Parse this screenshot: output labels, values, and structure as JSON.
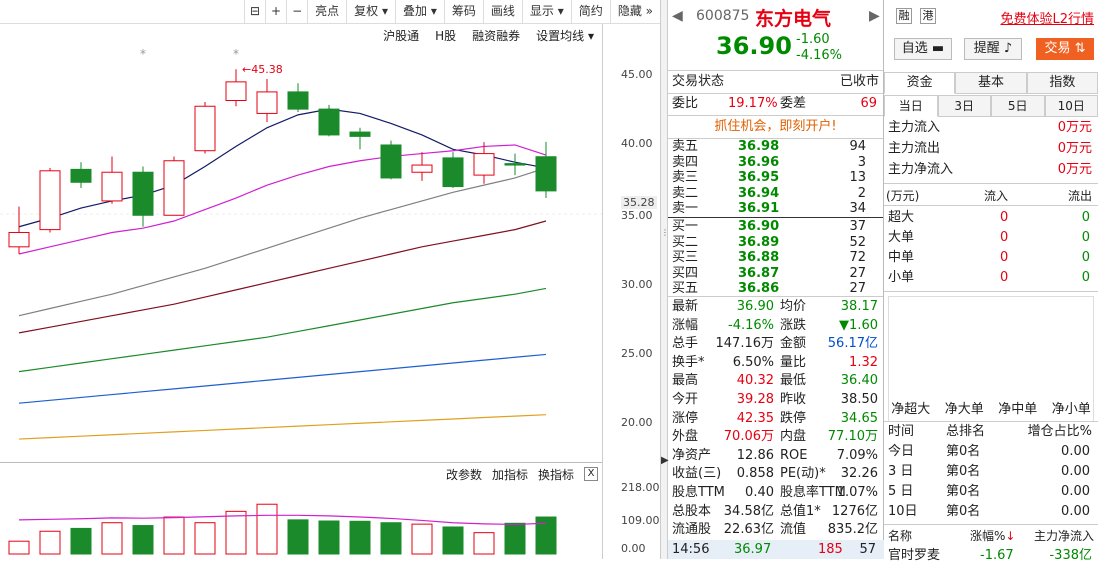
{
  "toolbar": {
    "items": [
      "亮点",
      "复权",
      "叠加",
      "筹码",
      "画线",
      "显示",
      "简约",
      "隐藏"
    ],
    "plus": "+",
    "minus": "−"
  },
  "chart_top": {
    "items": [
      "沪股通",
      "H股",
      "融资融券",
      "设置均线"
    ]
  },
  "peak_label": "45.38",
  "star": "*",
  "yaxis": {
    "price_labels": [
      "45.00",
      "40.00",
      "35.28",
      "35.00",
      "30.00",
      "25.00",
      "20.00"
    ],
    "vol_labels": [
      "218.00",
      "109.00",
      "0.00"
    ]
  },
  "vol_row": {
    "items": [
      "改参数",
      "加指标",
      "换指标"
    ],
    "close": "X"
  },
  "header": {
    "code": "600875",
    "name": "东方电气",
    "tag1": "融",
    "tag2": "港",
    "promo": "免费体验L2行情",
    "price": "36.90",
    "change": "-1.60",
    "pct": "-4.16%",
    "watch": "自选",
    "remind": "提醒",
    "trade": "交易"
  },
  "trade_status": {
    "label": "交易状态",
    "value": "已收市"
  },
  "weibi": {
    "l1": "委比",
    "v1": "19.17%",
    "l2": "委差",
    "v2": "69"
  },
  "banner": "抓住机会，即刻开户!",
  "sells": [
    {
      "n": "卖五",
      "p": "36.98",
      "v": "94"
    },
    {
      "n": "卖四",
      "p": "36.96",
      "v": "3"
    },
    {
      "n": "卖三",
      "p": "36.95",
      "v": "13"
    },
    {
      "n": "卖二",
      "p": "36.94",
      "v": "2"
    },
    {
      "n": "卖一",
      "p": "36.91",
      "v": "34"
    }
  ],
  "buys": [
    {
      "n": "买一",
      "p": "36.90",
      "v": "37"
    },
    {
      "n": "买二",
      "p": "36.89",
      "v": "52"
    },
    {
      "n": "买三",
      "p": "36.88",
      "v": "72"
    },
    {
      "n": "买四",
      "p": "36.87",
      "v": "27"
    },
    {
      "n": "买五",
      "p": "36.86",
      "v": "27"
    }
  ],
  "stats": [
    {
      "l1": "最新",
      "v1": "36.90",
      "c1": "green",
      "l2": "均价",
      "v2": "38.17",
      "c2": "green"
    },
    {
      "l1": "涨幅",
      "v1": "-4.16%",
      "c1": "green",
      "l2": "涨跌",
      "v2": "▼1.60",
      "c2": "green"
    },
    {
      "l1": "总手",
      "v1": "147.16万",
      "c1": "dark",
      "l2": "金额",
      "v2": "56.17亿",
      "c2": "blue"
    },
    {
      "l1": "换手*",
      "v1": "6.50%",
      "c1": "dark",
      "l2": "量比",
      "v2": "1.32",
      "c2": "red"
    },
    {
      "l1": "最高",
      "v1": "40.32",
      "c1": "red",
      "l2": "最低",
      "v2": "36.40",
      "c2": "green"
    },
    {
      "l1": "今开",
      "v1": "39.28",
      "c1": "red",
      "l2": "昨收",
      "v2": "38.50",
      "c2": "dark"
    },
    {
      "l1": "涨停",
      "v1": "42.35",
      "c1": "red",
      "l2": "跌停",
      "v2": "34.65",
      "c2": "green"
    },
    {
      "l1": "外盘",
      "v1": "70.06万",
      "c1": "red",
      "l2": "内盘",
      "v2": "77.10万",
      "c2": "green"
    },
    {
      "l1": "净资产",
      "v1": "12.86",
      "c1": "dark",
      "l2": "ROE",
      "v2": "7.09%",
      "c2": "dark"
    },
    {
      "l1": "收益(三)",
      "v1": "0.858",
      "c1": "dark",
      "l2": "PE(动)*",
      "v2": "32.26",
      "c2": "dark"
    },
    {
      "l1": "股息TTM",
      "v1": "0.40",
      "c1": "dark",
      "l2": "股息率TTM",
      "v2": "1.07%",
      "c2": "dark"
    },
    {
      "l1": "总股本",
      "v1": "34.58亿",
      "c1": "dark",
      "l2": "总值1*",
      "v2": "1276亿",
      "c2": "dark"
    },
    {
      "l1": "流通股",
      "v1": "22.63亿",
      "c1": "dark",
      "l2": "流值",
      "v2": "835.2亿",
      "c2": "dark"
    }
  ],
  "tick": {
    "time": "14:56",
    "price": "36.97",
    "vol": "185",
    "num": "57"
  },
  "right": {
    "tabs": [
      "资金",
      "基本",
      "指数"
    ],
    "subtabs": [
      "当日",
      "3日",
      "5日",
      "10日"
    ],
    "flows": [
      {
        "l": "主力流入",
        "v": "0万元"
      },
      {
        "l": "主力流出",
        "v": "0万元"
      },
      {
        "l": "主力净流入",
        "v": "0万元"
      }
    ],
    "table_head": {
      "unit": "(万元)",
      "in": "流入",
      "out": "流出"
    },
    "table": [
      {
        "l": "超大",
        "a": "0",
        "b": "0"
      },
      {
        "l": "大单",
        "a": "0",
        "b": "0"
      },
      {
        "l": "中单",
        "a": "0",
        "b": "0"
      },
      {
        "l": "小单",
        "a": "0",
        "b": "0"
      }
    ],
    "bar_labels": [
      "净超大",
      "净大单",
      "净中单",
      "净小单"
    ],
    "rank_head": {
      "a": "时间",
      "b": "总排名",
      "c": "增仓占比%"
    },
    "ranks": [
      {
        "t": "今日",
        "r": "第0名",
        "p": "0.00"
      },
      {
        "t": "3 日",
        "r": "第0名",
        "p": "0.00"
      },
      {
        "t": "5 日",
        "r": "第0名",
        "p": "0.00"
      },
      {
        "t": "10日",
        "r": "第0名",
        "p": "0.00"
      }
    ],
    "sector_head": {
      "a": "名称",
      "b": "涨幅%",
      "c": "主力净流入"
    },
    "sector": {
      "n": "官时罗麦",
      "p": "-1.67",
      "v": "-338亿"
    }
  },
  "chart_data": {
    "type": "candlestick",
    "candles": [
      {
        "o": 33.0,
        "h": 35.8,
        "l": 32.5,
        "c": 34.0
      },
      {
        "o": 34.2,
        "h": 38.5,
        "l": 34.0,
        "c": 38.3
      },
      {
        "o": 38.4,
        "h": 38.9,
        "l": 37.1,
        "c": 37.5
      },
      {
        "o": 36.2,
        "h": 39.3,
        "l": 36.0,
        "c": 38.2
      },
      {
        "o": 38.2,
        "h": 38.6,
        "l": 34.4,
        "c": 35.2
      },
      {
        "o": 35.2,
        "h": 39.3,
        "l": 35.2,
        "c": 39.0
      },
      {
        "o": 39.7,
        "h": 43.1,
        "l": 39.5,
        "c": 42.8
      },
      {
        "o": 43.2,
        "h": 45.38,
        "l": 42.8,
        "c": 44.5
      },
      {
        "o": 42.3,
        "h": 44.7,
        "l": 41.7,
        "c": 43.8
      },
      {
        "o": 43.8,
        "h": 44.4,
        "l": 42.4,
        "c": 42.6
      },
      {
        "o": 42.6,
        "h": 42.9,
        "l": 40.7,
        "c": 40.8
      },
      {
        "o": 41.0,
        "h": 41.3,
        "l": 39.8,
        "c": 40.7
      },
      {
        "o": 40.1,
        "h": 40.4,
        "l": 37.7,
        "c": 37.8
      },
      {
        "o": 38.2,
        "h": 39.6,
        "l": 37.6,
        "c": 38.7
      },
      {
        "o": 39.2,
        "h": 39.6,
        "l": 37.1,
        "c": 37.2
      },
      {
        "o": 38.0,
        "h": 40.3,
        "l": 37.4,
        "c": 39.5
      },
      {
        "o": 38.8,
        "h": 39.5,
        "l": 38.0,
        "c": 38.7
      },
      {
        "o": 39.28,
        "h": 40.32,
        "l": 36.4,
        "c": 36.9
      }
    ],
    "ma": [
      {
        "color": "#111a66",
        "values": [
          34.4,
          35.0,
          35.7,
          36.2,
          36.6,
          37.3,
          38.6,
          40.0,
          41.3,
          42.2,
          42.6,
          42.3,
          41.6,
          40.8,
          39.8,
          39.4,
          38.9,
          38.5
        ]
      },
      {
        "color": "#d020d0",
        "values": [
          32.5,
          33.0,
          33.5,
          34.0,
          34.3,
          34.8,
          35.6,
          36.4,
          37.3,
          38.0,
          38.6,
          39.0,
          39.3,
          39.5,
          39.7,
          40.0,
          40.1,
          39.4
        ]
      },
      {
        "color": "#808080",
        "values": [
          28.2,
          28.7,
          29.2,
          29.7,
          30.3,
          30.9,
          31.5,
          32.2,
          32.9,
          33.6,
          34.3,
          35.0,
          35.6,
          36.2,
          36.8,
          37.3,
          37.8,
          38.5
        ]
      },
      {
        "color": "#801020",
        "values": [
          27.0,
          27.4,
          27.8,
          28.2,
          28.6,
          29.0,
          29.5,
          30.0,
          30.5,
          31.0,
          31.5,
          32.0,
          32.5,
          33.0,
          33.4,
          33.8,
          34.2,
          34.8
        ]
      },
      {
        "color": "#1a8a2a",
        "values": [
          24.3,
          24.6,
          24.9,
          25.2,
          25.5,
          25.8,
          26.1,
          26.4,
          26.7,
          27.1,
          27.5,
          27.9,
          28.3,
          28.7,
          29.1,
          29.4,
          29.7,
          30.1
        ]
      },
      {
        "color": "#1e5fd0",
        "values": [
          22.1,
          22.3,
          22.5,
          22.7,
          22.9,
          23.1,
          23.3,
          23.5,
          23.7,
          23.9,
          24.1,
          24.3,
          24.5,
          24.7,
          24.9,
          25.1,
          25.3,
          25.5
        ]
      },
      {
        "color": "#e0a020",
        "values": [
          19.6,
          19.7,
          19.8,
          19.9,
          20.0,
          20.1,
          20.2,
          20.3,
          20.4,
          20.5,
          20.6,
          20.7,
          20.8,
          20.9,
          21.0,
          21.1,
          21.2,
          21.3
        ]
      }
    ],
    "volumes": [
      45,
      80,
      90,
      110,
      100,
      130,
      110,
      150,
      175,
      120,
      116,
      115,
      110,
      105,
      95,
      75,
      108,
      130
    ],
    "vol_ma": [
      120,
      122,
      124,
      127,
      126,
      128,
      131,
      134,
      136,
      136,
      134,
      130,
      125,
      118,
      110,
      106,
      104,
      108
    ],
    "ylim": [
      18.0,
      47.0
    ],
    "vol_ylim": [
      0,
      218
    ]
  }
}
